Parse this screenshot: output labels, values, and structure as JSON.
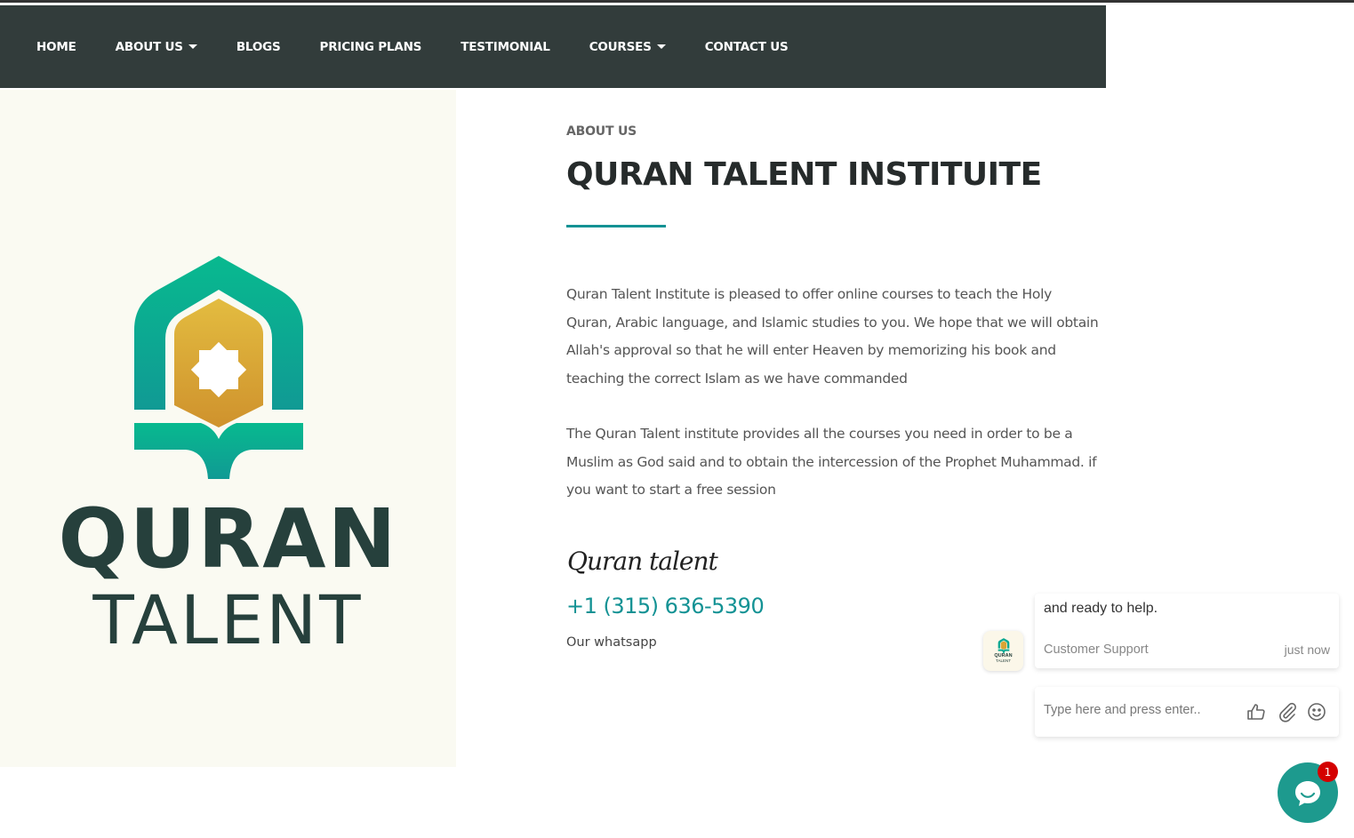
{
  "nav": {
    "items": [
      {
        "label": "HOME",
        "has_dropdown": false
      },
      {
        "label": "ABOUT US",
        "has_dropdown": true
      },
      {
        "label": "BLOGS",
        "has_dropdown": false
      },
      {
        "label": "PRICING PLANS",
        "has_dropdown": false
      },
      {
        "label": "TESTIMONIAL",
        "has_dropdown": false
      },
      {
        "label": "COURSES",
        "has_dropdown": true
      },
      {
        "label": "CONTACT US",
        "has_dropdown": false
      }
    ]
  },
  "logo": {
    "word1": "QURAN",
    "word2": "TALENT",
    "icon": "mosque-book-star-icon"
  },
  "about": {
    "eyebrow": "ABOUT US",
    "title": "QURAN TALENT INSTITUITE",
    "paragraph1": "Quran Talent Institute is pleased to offer online courses to teach the Holy Quran, Arabic language, and Islamic studies to you. We hope that we will obtain Allah's approval so that he will enter Heaven by memorizing his book and teaching the correct Islam as we have commanded",
    "paragraph2": "The Quran Talent institute provides all the courses you need in order to be a Muslim as God said and to obtain the intercession of the Prophet Muhammad. if you want to start a free session",
    "signature": "Quran talent",
    "phone": "+1 (315) 636-5390",
    "phone_caption": "Our whatsapp"
  },
  "chat": {
    "message": "and ready to help.",
    "from": "Customer Support",
    "time": "just now",
    "avatar_text_line1": "QURAN",
    "avatar_text_line2": "TALENT",
    "input_placeholder": "Type here and press enter..",
    "tools": [
      "thumbs-up-icon",
      "paperclip-icon",
      "smiley-icon"
    ],
    "unread_count": "1"
  },
  "colors": {
    "nav_bg": "#323c3b",
    "accent_teal": "#139294",
    "logo_dark": "#26403c",
    "logo_gold": "#d6a435",
    "panel_bg": "#fafaf2",
    "badge_red": "#d40000"
  }
}
